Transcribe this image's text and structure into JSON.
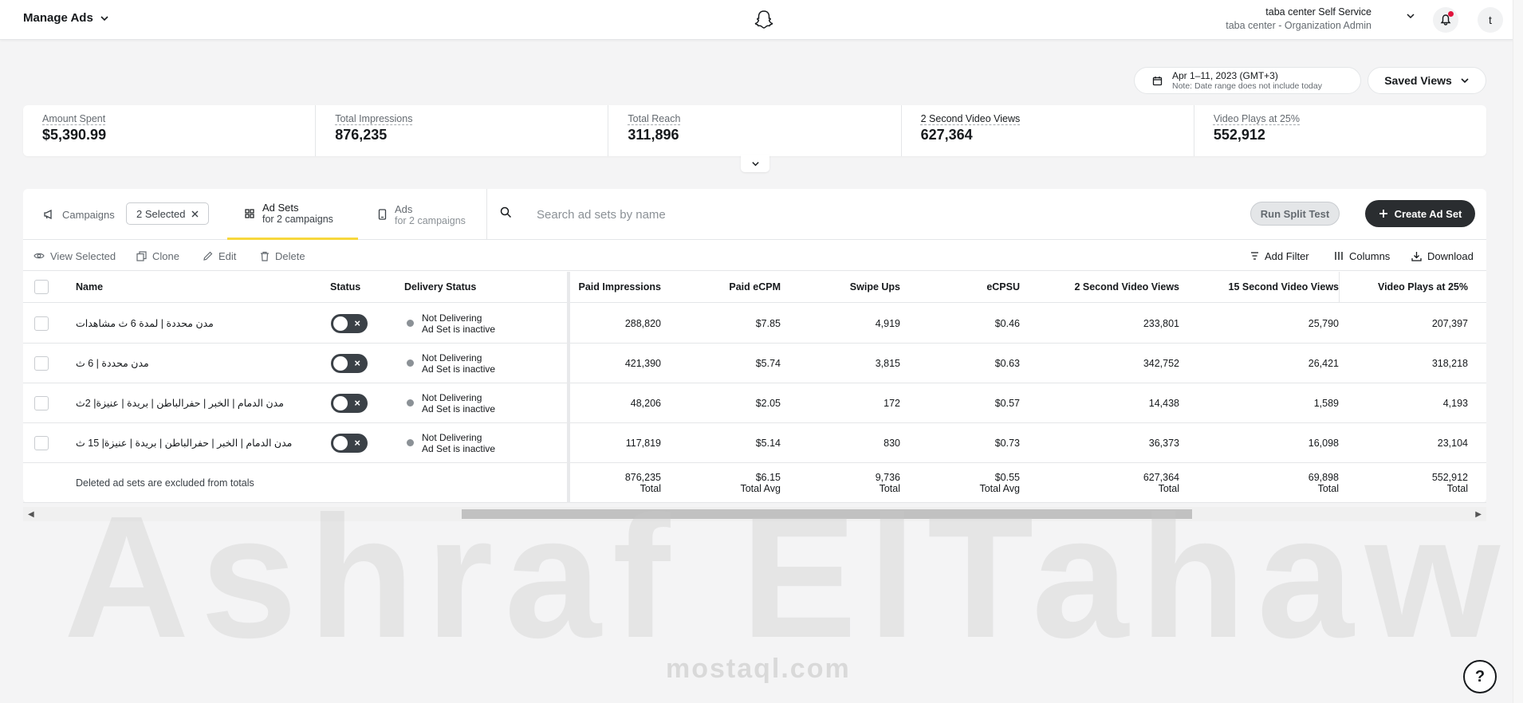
{
  "header": {
    "menu_label": "Manage Ads",
    "org_name": "taba center Self Service",
    "org_role": "taba center - Organization Admin",
    "avatar_initial": "t"
  },
  "date_range": {
    "label": "Apr 1–11, 2023 (GMT+3)",
    "note": "Note: Date range does not include today"
  },
  "saved_views_label": "Saved Views",
  "stats": [
    {
      "label": "Amount Spent",
      "value": "$5,390.99"
    },
    {
      "label": "Total Impressions",
      "value": "876,235"
    },
    {
      "label": "Total Reach",
      "value": "311,896"
    },
    {
      "label": "2 Second Video Views",
      "value": "627,364"
    },
    {
      "label": "Video Plays at 25%",
      "value": "552,912"
    }
  ],
  "tabs": {
    "campaigns": "Campaigns",
    "selected_chip": "2 Selected",
    "adsets_title": "Ad Sets",
    "adsets_sub": "for 2 campaigns",
    "ads_title": "Ads",
    "ads_sub": "for 2 campaigns"
  },
  "search": {
    "placeholder": "Search ad sets by name"
  },
  "buttons": {
    "split_test": "Run Split Test",
    "create": "Create Ad Set"
  },
  "toolbar": {
    "view_selected": "View Selected",
    "clone": "Clone",
    "edit": "Edit",
    "delete": "Delete",
    "add_filter": "Add Filter",
    "columns": "Columns",
    "download": "Download"
  },
  "table": {
    "columns": {
      "name": "Name",
      "status": "Status",
      "delivery": "Delivery Status",
      "paid_impressions": "Paid Impressions",
      "paid_ecpm": "Paid eCPM",
      "swipe_ups": "Swipe Ups",
      "ecpsu": "eCPSU",
      "video_2s": "2 Second Video Views",
      "video_15s": "15 Second Video Views",
      "plays_25": "Video Plays at 25%"
    },
    "rows": [
      {
        "name": "مدن محددة | لمدة 6 ث مشاهدات",
        "delivery_1": "Not Delivering",
        "delivery_2": "Ad Set is inactive",
        "paid_impressions": "288,820",
        "paid_ecpm": "$7.85",
        "swipe_ups": "4,919",
        "ecpsu": "$0.46",
        "video_2s": "233,801",
        "video_15s": "25,790",
        "plays_25": "207,397"
      },
      {
        "name": "مدن محددة | 6 ث",
        "delivery_1": "Not Delivering",
        "delivery_2": "Ad Set is inactive",
        "paid_impressions": "421,390",
        "paid_ecpm": "$5.74",
        "swipe_ups": "3,815",
        "ecpsu": "$0.63",
        "video_2s": "342,752",
        "video_15s": "26,421",
        "plays_25": "318,218"
      },
      {
        "name": "مدن الدمام | الخبر | حفرالباطن | بريدة | عنيزة| 2ث",
        "delivery_1": "Not Delivering",
        "delivery_2": "Ad Set is inactive",
        "paid_impressions": "48,206",
        "paid_ecpm": "$2.05",
        "swipe_ups": "172",
        "ecpsu": "$0.57",
        "video_2s": "14,438",
        "video_15s": "1,589",
        "plays_25": "4,193"
      },
      {
        "name": "مدن الدمام | الخبر | حفرالباطن | بريدة | عنيزة| 15 ث",
        "delivery_1": "Not Delivering",
        "delivery_2": "Ad Set is inactive",
        "paid_impressions": "117,819",
        "paid_ecpm": "$5.14",
        "swipe_ups": "830",
        "ecpsu": "$0.73",
        "video_2s": "36,373",
        "video_15s": "16,098",
        "plays_25": "23,104"
      }
    ],
    "totals": {
      "note": "Deleted ad sets are excluded from totals",
      "paid_impressions": "876,235",
      "paid_impressions_lbl": "Total",
      "paid_ecpm": "$6.15",
      "paid_ecpm_lbl": "Total Avg",
      "swipe_ups": "9,736",
      "swipe_ups_lbl": "Total",
      "ecpsu": "$0.55",
      "ecpsu_lbl": "Total Avg",
      "video_2s": "627,364",
      "video_2s_lbl": "Total",
      "video_15s": "69,898",
      "video_15s_lbl": "Total",
      "plays_25": "552,912",
      "plays_25_lbl": "Total"
    }
  },
  "watermark": {
    "text": "Ashraf ElTahawy",
    "site": "mostaql.com"
  }
}
